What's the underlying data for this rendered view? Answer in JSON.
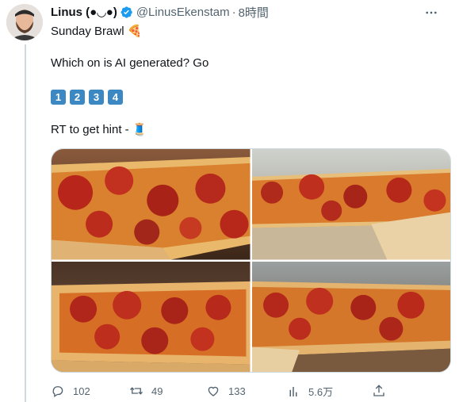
{
  "author": {
    "display_name": "Linus (●◡●)",
    "handle": "@LinusEkenstam",
    "separator": "·",
    "time": "8時間"
  },
  "tweet": {
    "line1": "Sunday Brawl 🍕",
    "line2": "Which on is AI generated? Go",
    "keycaps": [
      "1",
      "2",
      "3",
      "4"
    ],
    "line4": "RT to get hint - 🧵"
  },
  "actions": {
    "replies": "102",
    "retweets": "49",
    "likes": "133",
    "views": "5.6万"
  },
  "icons": {
    "verified": "verified-badge-icon",
    "more": "more-icon",
    "reply": "reply-icon",
    "retweet": "retweet-icon",
    "like": "heart-icon",
    "views": "views-icon",
    "share": "share-icon"
  },
  "colors": {
    "accent": "#1d9bf0",
    "keycap": "#3b88c3",
    "muted": "#536471"
  }
}
